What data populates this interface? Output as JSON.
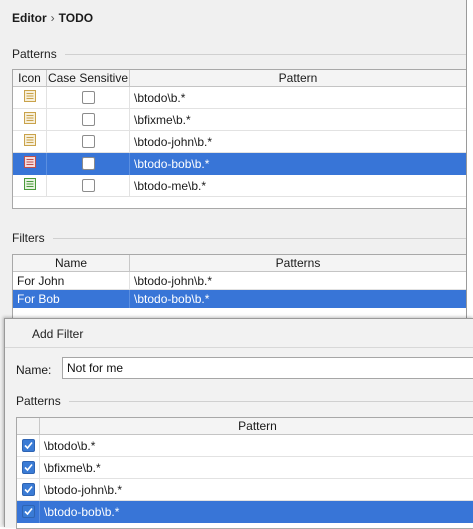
{
  "breadcrumb": {
    "parent": "Editor",
    "separator": "›",
    "current": "TODO"
  },
  "patterns_section": {
    "label": "Patterns",
    "columns": {
      "icon": "Icon",
      "case_sensitive": "Case Sensitive",
      "pattern": "Pattern"
    },
    "rows": [
      {
        "icon": "todo-icon-default",
        "case_sensitive": false,
        "pattern": "\\btodo\\b.*",
        "selected": false
      },
      {
        "icon": "todo-icon-default",
        "case_sensitive": false,
        "pattern": "\\bfixme\\b.*",
        "selected": false
      },
      {
        "icon": "todo-icon-default",
        "case_sensitive": false,
        "pattern": "\\btodo-john\\b.*",
        "selected": false
      },
      {
        "icon": "todo-icon-red",
        "case_sensitive": false,
        "pattern": "\\btodo-bob\\b.*",
        "selected": true
      },
      {
        "icon": "todo-icon-green",
        "case_sensitive": false,
        "pattern": "\\btodo-me\\b.*",
        "selected": false
      }
    ]
  },
  "filters_section": {
    "label": "Filters",
    "columns": {
      "name": "Name",
      "patterns": "Patterns"
    },
    "rows": [
      {
        "name": "For John",
        "patterns": "\\btodo-john\\b.*",
        "selected": false
      },
      {
        "name": "For Bob",
        "patterns": "\\btodo-bob\\b.*",
        "selected": true
      }
    ]
  },
  "add_filter_dialog": {
    "title": "Add Filter",
    "name_label": "Name:",
    "name_value": "Not for me",
    "patterns_label": "Patterns",
    "columns": {
      "check": "",
      "pattern": "Pattern"
    },
    "rows": [
      {
        "checked": true,
        "pattern": "\\btodo\\b.*",
        "selected": false
      },
      {
        "checked": true,
        "pattern": "\\bfixme\\b.*",
        "selected": false
      },
      {
        "checked": true,
        "pattern": "\\btodo-john\\b.*",
        "selected": false
      },
      {
        "checked": true,
        "pattern": "\\btodo-bob\\b.*",
        "selected": true
      }
    ]
  },
  "colors": {
    "selection": "#3875d7",
    "checkbox_checked": "#3a7bd5",
    "window_bg": "#f0f0f0"
  }
}
